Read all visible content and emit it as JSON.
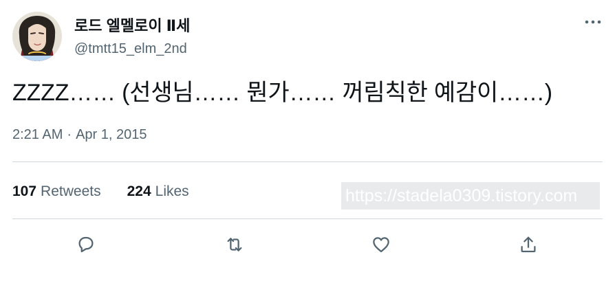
{
  "tweet": {
    "author": {
      "display_name": "로드 엘멜로이 Ⅱ세",
      "handle": "@tmtt15_elm_2nd"
    },
    "text": "ZZZZ…… (선생님…… 뭔가…… 꺼림칙한 예감이……)",
    "time": "2:21 AM",
    "separator": "·",
    "date": "Apr 1, 2015",
    "stats": {
      "retweets_count": "107",
      "retweets_label": "Retweets",
      "likes_count": "224",
      "likes_label": "Likes"
    },
    "watermark": "https://stadela0309.tistory.com"
  },
  "colors": {
    "text_primary": "#0f1419",
    "text_secondary": "#536471",
    "divider": "#cfd9de",
    "watermark_bg": "#e9eaeb"
  },
  "icons": {
    "more": "more-horizontal-icon",
    "reply": "reply-icon",
    "retweet": "retweet-icon",
    "like": "heart-icon",
    "share": "share-icon"
  }
}
